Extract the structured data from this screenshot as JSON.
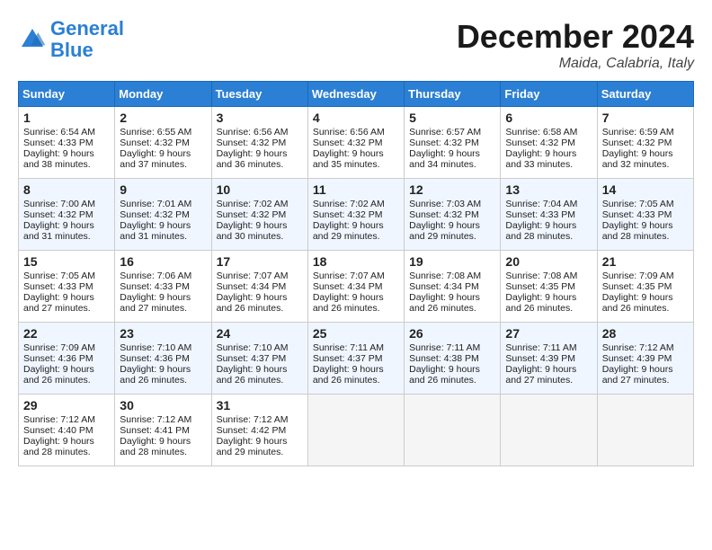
{
  "header": {
    "logo_line1": "General",
    "logo_line2": "Blue",
    "month_year": "December 2024",
    "location": "Maida, Calabria, Italy"
  },
  "days_of_week": [
    "Sunday",
    "Monday",
    "Tuesday",
    "Wednesday",
    "Thursday",
    "Friday",
    "Saturday"
  ],
  "weeks": [
    [
      {
        "day": "1",
        "sunrise": "6:54 AM",
        "sunset": "4:33 PM",
        "daylight": "9 hours and 38 minutes."
      },
      {
        "day": "2",
        "sunrise": "6:55 AM",
        "sunset": "4:32 PM",
        "daylight": "9 hours and 37 minutes."
      },
      {
        "day": "3",
        "sunrise": "6:56 AM",
        "sunset": "4:32 PM",
        "daylight": "9 hours and 36 minutes."
      },
      {
        "day": "4",
        "sunrise": "6:56 AM",
        "sunset": "4:32 PM",
        "daylight": "9 hours and 35 minutes."
      },
      {
        "day": "5",
        "sunrise": "6:57 AM",
        "sunset": "4:32 PM",
        "daylight": "9 hours and 34 minutes."
      },
      {
        "day": "6",
        "sunrise": "6:58 AM",
        "sunset": "4:32 PM",
        "daylight": "9 hours and 33 minutes."
      },
      {
        "day": "7",
        "sunrise": "6:59 AM",
        "sunset": "4:32 PM",
        "daylight": "9 hours and 32 minutes."
      }
    ],
    [
      {
        "day": "8",
        "sunrise": "7:00 AM",
        "sunset": "4:32 PM",
        "daylight": "9 hours and 31 minutes."
      },
      {
        "day": "9",
        "sunrise": "7:01 AM",
        "sunset": "4:32 PM",
        "daylight": "9 hours and 31 minutes."
      },
      {
        "day": "10",
        "sunrise": "7:02 AM",
        "sunset": "4:32 PM",
        "daylight": "9 hours and 30 minutes."
      },
      {
        "day": "11",
        "sunrise": "7:02 AM",
        "sunset": "4:32 PM",
        "daylight": "9 hours and 29 minutes."
      },
      {
        "day": "12",
        "sunrise": "7:03 AM",
        "sunset": "4:32 PM",
        "daylight": "9 hours and 29 minutes."
      },
      {
        "day": "13",
        "sunrise": "7:04 AM",
        "sunset": "4:33 PM",
        "daylight": "9 hours and 28 minutes."
      },
      {
        "day": "14",
        "sunrise": "7:05 AM",
        "sunset": "4:33 PM",
        "daylight": "9 hours and 28 minutes."
      }
    ],
    [
      {
        "day": "15",
        "sunrise": "7:05 AM",
        "sunset": "4:33 PM",
        "daylight": "9 hours and 27 minutes."
      },
      {
        "day": "16",
        "sunrise": "7:06 AM",
        "sunset": "4:33 PM",
        "daylight": "9 hours and 27 minutes."
      },
      {
        "day": "17",
        "sunrise": "7:07 AM",
        "sunset": "4:34 PM",
        "daylight": "9 hours and 26 minutes."
      },
      {
        "day": "18",
        "sunrise": "7:07 AM",
        "sunset": "4:34 PM",
        "daylight": "9 hours and 26 minutes."
      },
      {
        "day": "19",
        "sunrise": "7:08 AM",
        "sunset": "4:34 PM",
        "daylight": "9 hours and 26 minutes."
      },
      {
        "day": "20",
        "sunrise": "7:08 AM",
        "sunset": "4:35 PM",
        "daylight": "9 hours and 26 minutes."
      },
      {
        "day": "21",
        "sunrise": "7:09 AM",
        "sunset": "4:35 PM",
        "daylight": "9 hours and 26 minutes."
      }
    ],
    [
      {
        "day": "22",
        "sunrise": "7:09 AM",
        "sunset": "4:36 PM",
        "daylight": "9 hours and 26 minutes."
      },
      {
        "day": "23",
        "sunrise": "7:10 AM",
        "sunset": "4:36 PM",
        "daylight": "9 hours and 26 minutes."
      },
      {
        "day": "24",
        "sunrise": "7:10 AM",
        "sunset": "4:37 PM",
        "daylight": "9 hours and 26 minutes."
      },
      {
        "day": "25",
        "sunrise": "7:11 AM",
        "sunset": "4:37 PM",
        "daylight": "9 hours and 26 minutes."
      },
      {
        "day": "26",
        "sunrise": "7:11 AM",
        "sunset": "4:38 PM",
        "daylight": "9 hours and 26 minutes."
      },
      {
        "day": "27",
        "sunrise": "7:11 AM",
        "sunset": "4:39 PM",
        "daylight": "9 hours and 27 minutes."
      },
      {
        "day": "28",
        "sunrise": "7:12 AM",
        "sunset": "4:39 PM",
        "daylight": "9 hours and 27 minutes."
      }
    ],
    [
      {
        "day": "29",
        "sunrise": "7:12 AM",
        "sunset": "4:40 PM",
        "daylight": "9 hours and 28 minutes."
      },
      {
        "day": "30",
        "sunrise": "7:12 AM",
        "sunset": "4:41 PM",
        "daylight": "9 hours and 28 minutes."
      },
      {
        "day": "31",
        "sunrise": "7:12 AM",
        "sunset": "4:42 PM",
        "daylight": "9 hours and 29 minutes."
      },
      null,
      null,
      null,
      null
    ]
  ]
}
